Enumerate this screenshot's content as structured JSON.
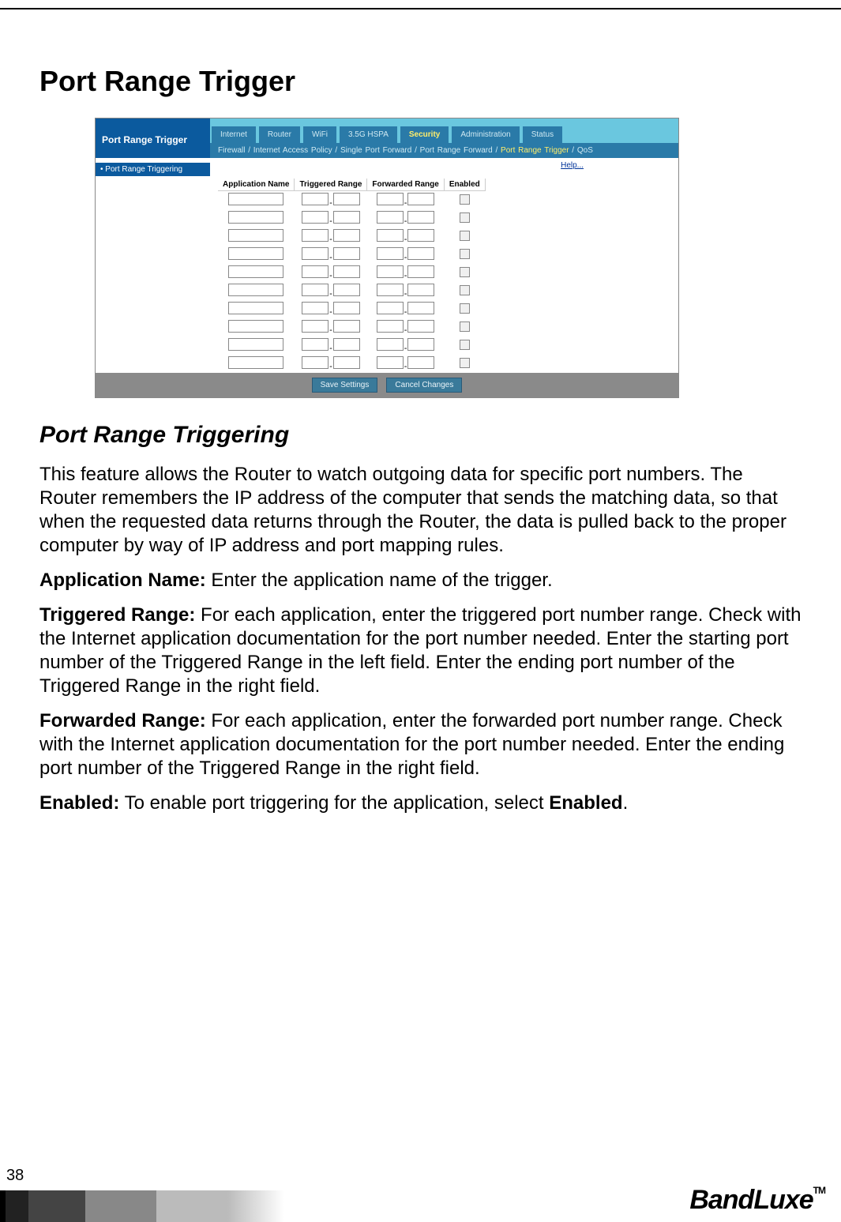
{
  "page_number": "38",
  "title": "Port Range Trigger",
  "subtitle": "Port Range Triggering",
  "paragraphs": {
    "intro": "This feature allows the Router to watch outgoing data for specific port numbers. The Router remembers the IP address of the computer that sends the matching data, so that when the requested data returns through the Router, the data is pulled back to the proper computer by way of IP address and port mapping rules.",
    "app_label": "Application Name:",
    "app_text": " Enter the application name of the trigger.",
    "trig_label": "Triggered Range:",
    "trig_text": " For each application, enter the triggered port number range. Check with the Internet application documentation for the port number needed. Enter the starting port number of the Triggered Range in the left field. Enter the ending port number of the Triggered Range in the right field.",
    "fwd_label": "Forwarded Range:",
    "fwd_text": " For each application, enter the forwarded port number range. Check with the Internet application documentation for the port number needed. Enter the ending port number of the Triggered Range in the right field.",
    "en_label": "Enabled:",
    "en_text": " To enable port triggering for the application, select ",
    "en_bold": "Enabled",
    "en_tail": "."
  },
  "screenshot": {
    "left_title": "Port Range Trigger",
    "tabs": [
      "Internet",
      "Router",
      "WiFi",
      "3.5G HSPA",
      "Security",
      "Administration",
      "Status"
    ],
    "active_tab_index": 4,
    "subnav_prefix": "Firewall  /  Internet Access Policy  /  Single Port Forward  /  Port Range Forward  /  ",
    "subnav_current": "Port Range Trigger",
    "subnav_suffix": "  /  QoS",
    "side_item": "Port Range Triggering",
    "help": "Help...",
    "columns": [
      "Application Name",
      "Triggered Range",
      "Forwarded Range",
      "Enabled"
    ],
    "row_count": 10,
    "buttons": {
      "save": "Save Settings",
      "cancel": "Cancel Changes"
    }
  },
  "brand": "BandLuxe",
  "brand_tm": "TM"
}
